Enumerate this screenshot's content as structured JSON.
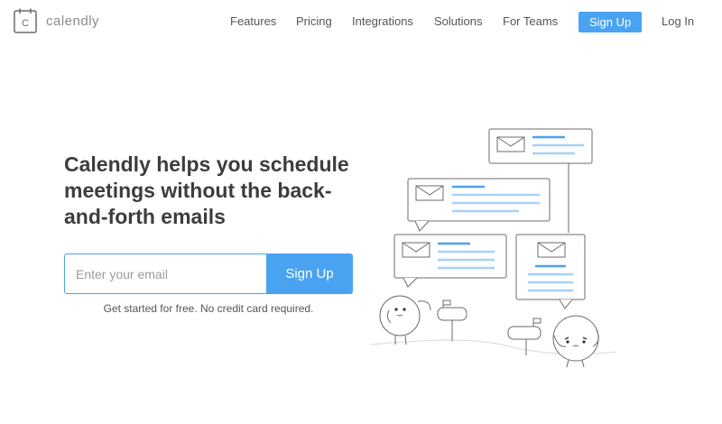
{
  "brand": {
    "name": "calendly",
    "logo_glyph": "C",
    "accent": "#4aa3f0"
  },
  "nav": {
    "items": [
      {
        "label": "Features"
      },
      {
        "label": "Pricing"
      },
      {
        "label": "Integrations"
      },
      {
        "label": "Solutions"
      },
      {
        "label": "For Teams"
      }
    ],
    "signup_label": "Sign Up",
    "login_label": "Log In"
  },
  "hero": {
    "headline": "Calendly helps you schedule meetings without the back-and-forth emails",
    "email_placeholder": "Enter your email",
    "email_value": "",
    "signup_button": "Sign Up",
    "subtext": "Get started for free. No credit card required."
  },
  "illustration": {
    "icons": [
      "envelope-icon",
      "envelope-icon",
      "envelope-icon",
      "envelope-icon"
    ],
    "characters": [
      "character-left",
      "character-right"
    ]
  }
}
